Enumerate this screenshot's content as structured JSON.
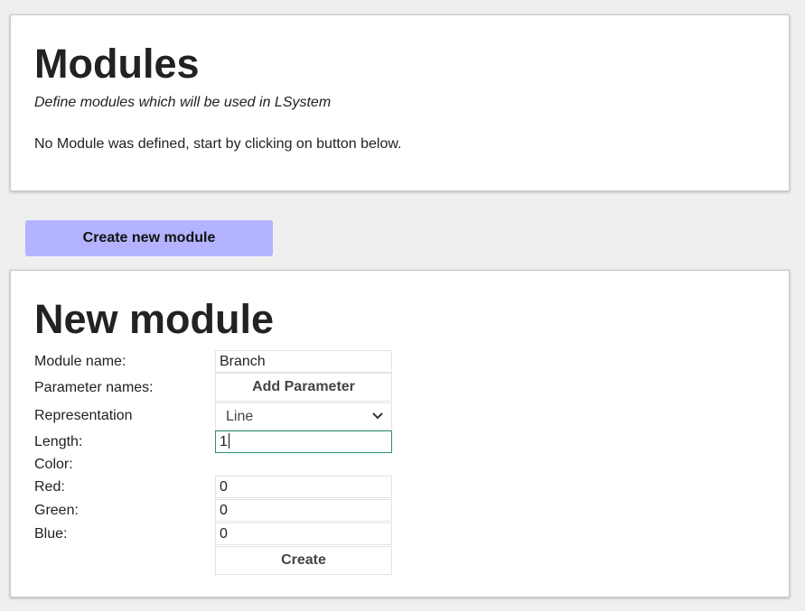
{
  "modules_section": {
    "title": "Modules",
    "subtitle": "Define modules which will be used in LSystem",
    "empty_message": "No Module was defined, start by clicking on button below."
  },
  "create_new_module_button": "Create new module",
  "new_module_form": {
    "title": "New module",
    "module_name_label": "Module name:",
    "module_name_value": "Branch",
    "parameter_names_label": "Parameter names:",
    "add_parameter_button": "Add Parameter",
    "representation_label": "Representation",
    "representation_value": "Line",
    "length_label": "Length:",
    "length_value": "1",
    "color_label": "Color:",
    "red_label": "Red:",
    "red_value": "0",
    "green_label": "Green:",
    "green_value": "0",
    "blue_label": "Blue:",
    "blue_value": "0",
    "create_button": "Create"
  },
  "colors": {
    "page_background": "#efefef",
    "card_background": "#ffffff",
    "accent_button": "#b3b3ff",
    "focus_border": "#2a8f6f"
  }
}
